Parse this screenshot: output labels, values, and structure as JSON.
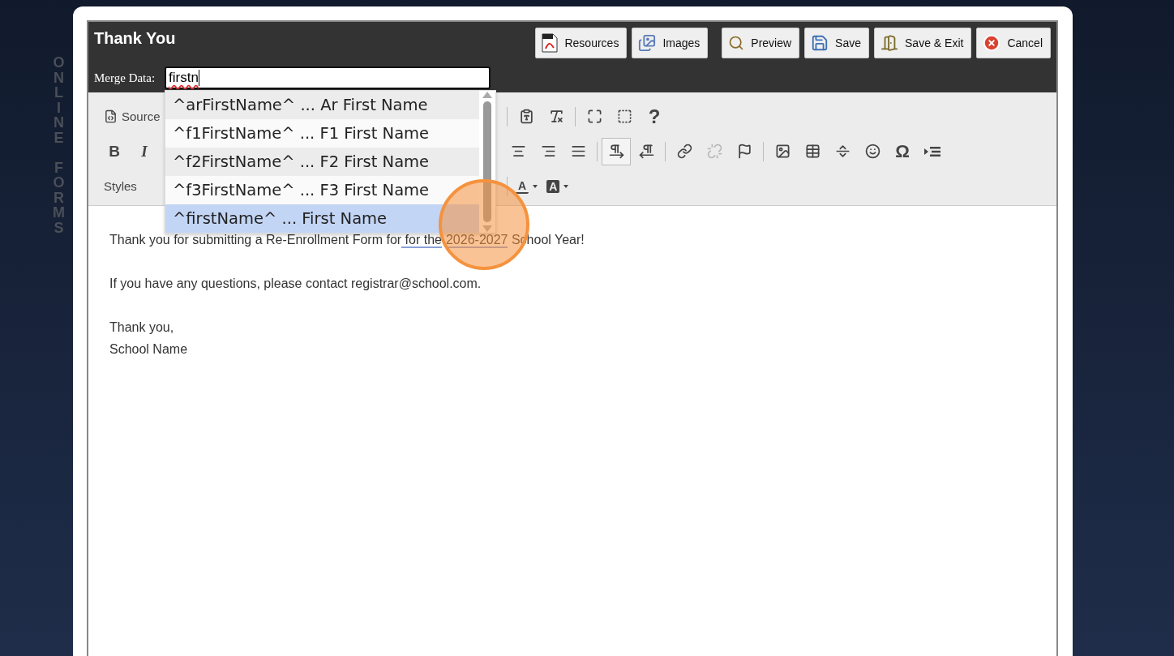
{
  "side_label": "ONLINE FORMS",
  "dialog": {
    "title": "Thank You",
    "button_groups": [
      [
        {
          "kind": "pdf",
          "label": "Resources"
        },
        {
          "kind": "images",
          "label": "Images"
        }
      ],
      [
        {
          "kind": "preview",
          "label": "Preview"
        },
        {
          "kind": "save",
          "label": "Save"
        },
        {
          "kind": "save-exit",
          "label": "Save & Exit"
        },
        {
          "kind": "cancel",
          "label": "Cancel"
        }
      ]
    ],
    "merge_data": {
      "label": "Merge Data:",
      "value": "firstn"
    },
    "suggestions": [
      {
        "text": "^arFirstName^ ... Ar First Name",
        "selected": false
      },
      {
        "text": "^f1FirstName^ ... F1 First Name",
        "selected": false
      },
      {
        "text": "^f2FirstName^ ... F2 First Name",
        "selected": false
      },
      {
        "text": "^f3FirstName^ ... F3 First Name",
        "selected": false
      },
      {
        "text": "^firstName^ ... First Name",
        "selected": true
      }
    ],
    "toolbar": [
      {
        "left": [
          {
            "kind": "source",
            "label": "Source",
            "active": false,
            "disabled": false
          }
        ],
        "right": [
          {
            "kind": "separator"
          },
          {
            "kind": "paste-text",
            "active": false,
            "disabled": false
          },
          {
            "kind": "remove-format",
            "active": false,
            "disabled": false
          },
          {
            "kind": "separator"
          },
          {
            "kind": "maximize",
            "active": false,
            "disabled": false
          },
          {
            "kind": "show-blocks",
            "active": false,
            "disabled": false
          },
          {
            "kind": "help",
            "label": "?",
            "active": false,
            "disabled": false
          }
        ]
      },
      {
        "left": [
          {
            "kind": "bold",
            "label": "B",
            "active": false,
            "disabled": false
          },
          {
            "kind": "italic",
            "label": "I",
            "active": false,
            "disabled": false
          }
        ],
        "right": [
          {
            "kind": "align-center",
            "active": false,
            "disabled": false
          },
          {
            "kind": "align-right",
            "active": false,
            "disabled": false
          },
          {
            "kind": "align-justify",
            "active": false,
            "disabled": false
          },
          {
            "kind": "separator"
          },
          {
            "kind": "ltr",
            "active": true,
            "disabled": false
          },
          {
            "kind": "rtl",
            "active": false,
            "disabled": false
          },
          {
            "kind": "separator"
          },
          {
            "kind": "link",
            "active": false,
            "disabled": false
          },
          {
            "kind": "unlink",
            "active": false,
            "disabled": true
          },
          {
            "kind": "anchor",
            "active": false,
            "disabled": false
          },
          {
            "kind": "separator"
          },
          {
            "kind": "image",
            "active": false,
            "disabled": false
          },
          {
            "kind": "table",
            "active": false,
            "disabled": false
          },
          {
            "kind": "horizontal-rule",
            "active": false,
            "disabled": false
          },
          {
            "kind": "smiley",
            "active": false,
            "disabled": false
          },
          {
            "kind": "special-char",
            "label": "Ω",
            "active": false,
            "disabled": false
          },
          {
            "kind": "create-div",
            "active": false,
            "disabled": false
          }
        ]
      },
      {
        "left": [
          {
            "kind": "styles",
            "label": "Styles",
            "active": false,
            "disabled": false
          }
        ],
        "right": [
          {
            "kind": "separator"
          },
          {
            "kind": "text-color",
            "label": "A",
            "active": false,
            "disabled": false
          },
          {
            "kind": "bg-color",
            "label": "A",
            "active": false,
            "disabled": false
          }
        ]
      }
    ],
    "body": [
      [
        [
          {
            "text": "Thank you for submitting a Re-Enrollment Form for",
            "underlined": false
          },
          {
            "text": " for the",
            "underlined": true
          },
          {
            "text": "2026-2027",
            "underlined": true
          },
          {
            "text": " School Year!",
            "underlined": false
          }
        ]
      ],
      [
        [
          {
            "text": "If you have any questions, please contact registrar@school.com.",
            "underlined": false
          }
        ]
      ],
      [
        [
          {
            "text": "Thank you,",
            "underlined": false
          }
        ],
        [
          {
            "text": "School Name",
            "underlined": false
          }
        ]
      ]
    ]
  }
}
